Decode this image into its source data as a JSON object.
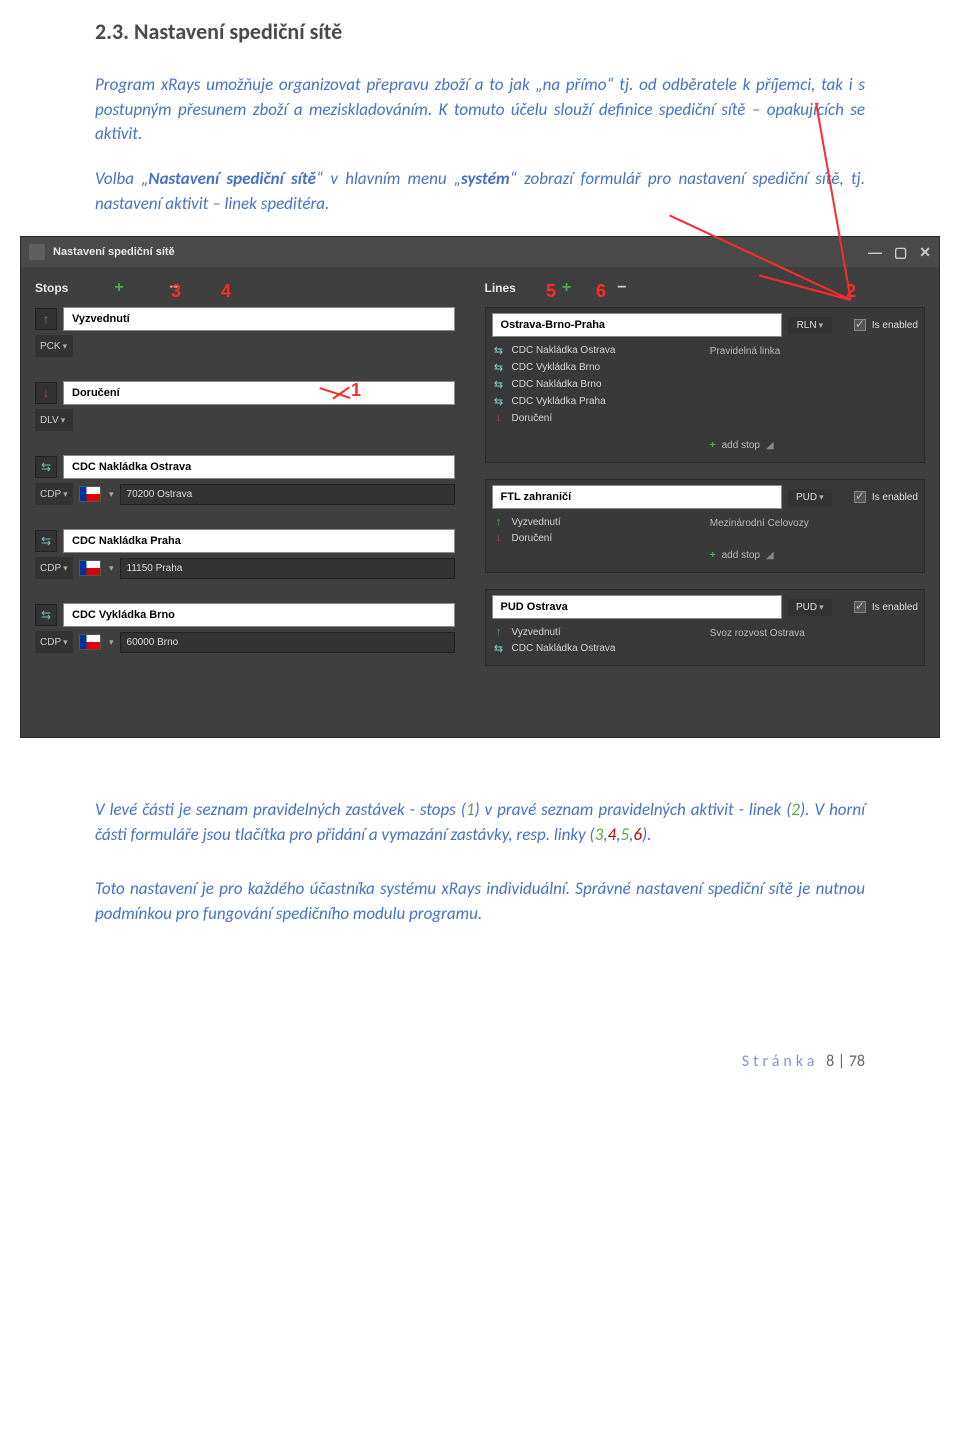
{
  "heading": "2.3. Nastavení spediční sítě",
  "para1": "Program xRays umožňuje organizovat přepravu zboží a to jak „na přímo“ tj. od odběratele k příjemci, tak i s postupným přesunem zboží a meziskladováním. K tomuto účelu slouží definice spediční sítě – opakujících se aktivit.",
  "para2_pre": "Volba „",
  "para2_b1": "Nastavení spediční sítě",
  "para2_mid": "“ v hlavním menu „",
  "para2_b2": "systém",
  "para2_post": "“ zobrazí formulář pro nastavení spediční sítě, tj. nastavení aktivit – linek speditéra.",
  "shot": {
    "title": "Nastavení spediční sítě",
    "win_min": "—",
    "win_max": "▢",
    "win_close": "✕",
    "stops_label": "Stops",
    "lines_label": "Lines",
    "plus": "+",
    "minus": "−",
    "anno1": "1",
    "anno2": "2",
    "anno3": "3",
    "anno4": "4",
    "anno5": "5",
    "anno6": "6",
    "stops": [
      {
        "name": "Vyzvednutí",
        "code": "PCK",
        "icon": "↑",
        "iconcls": "green"
      },
      {
        "name": "Doručení",
        "code": "DLV",
        "icon": "↓",
        "iconcls": "red"
      },
      {
        "name": "CDC Nakládka Ostrava",
        "code": "CDP",
        "postal": "70200 Ostrava",
        "flag": true,
        "icon": "⇆",
        "iconcls": "cyan"
      },
      {
        "name": "CDC Nakládka Praha",
        "code": "CDP",
        "postal": "11150 Praha",
        "flag": true,
        "icon": "⇆",
        "iconcls": "cyan"
      },
      {
        "name": "CDC Vykládka Brno",
        "code": "CDP",
        "postal": "60000 Brno",
        "flag": true,
        "icon": "⇆",
        "iconcls": "cyan"
      }
    ],
    "lines": [
      {
        "name": "Ostrava-Brno-Praha",
        "tag": "RLN",
        "enabled": true,
        "enabled_lbl": "Is enabled",
        "note": "Pravidelná linka",
        "items": [
          {
            "icon": "⇆",
            "cls": "cyan",
            "text": "CDC Nakládka Ostrava"
          },
          {
            "icon": "⇆",
            "cls": "cyan",
            "text": "CDC Vykládka Brno"
          },
          {
            "icon": "⇆",
            "cls": "cyan",
            "text": "CDC Nakládka Brno"
          },
          {
            "icon": "⇆",
            "cls": "cyan",
            "text": "CDC Vykládka Praha"
          },
          {
            "icon": "↓",
            "cls": "red",
            "text": "Doručení"
          }
        ],
        "add_stop": "add stop"
      },
      {
        "name": "FTL zahraničí",
        "tag": "PUD",
        "enabled": true,
        "enabled_lbl": "Is enabled",
        "note": "Mezinárodní Celovozy",
        "items": [
          {
            "icon": "↑",
            "cls": "green",
            "text": "Vyzvednutí"
          },
          {
            "icon": "↓",
            "cls": "red",
            "text": "Doručení"
          }
        ],
        "add_stop": "add stop"
      },
      {
        "name": "PUD Ostrava",
        "tag": "PUD",
        "enabled": true,
        "enabled_lbl": "Is enabled",
        "note": "Svoz rozvost Ostrava",
        "items": [
          {
            "icon": "↑",
            "cls": "green",
            "text": "Vyzvednutí"
          },
          {
            "icon": "⇆",
            "cls": "cyan",
            "text": "CDC Nakládka Ostrava"
          }
        ]
      }
    ]
  },
  "below1_a": "V levé části je seznam pravidelných zastávek - stops (",
  "below1_1": "1",
  "below1_b": ") v pravé seznam pravidelných aktivit - linek (",
  "below1_2": "2",
  "below1_c": "). V horní části formuláře jsou tlačítka pro přidání a vymazání zastávky, resp. linky (",
  "below1_3": "3",
  "below1_com1": ",",
  "below1_4": "4",
  "below1_com2": ",",
  "below1_5": "5",
  "below1_com3": ",",
  "below1_6": "6",
  "below1_d": ").",
  "below2": "Toto nastavení je pro každého účastníka systému xRays individuální. Správné nastavení spediční sítě je nutnou podmínkou pro fungování spedičního modulu programu.",
  "footer_label": "Stránka",
  "footer_page": "8 | 78"
}
